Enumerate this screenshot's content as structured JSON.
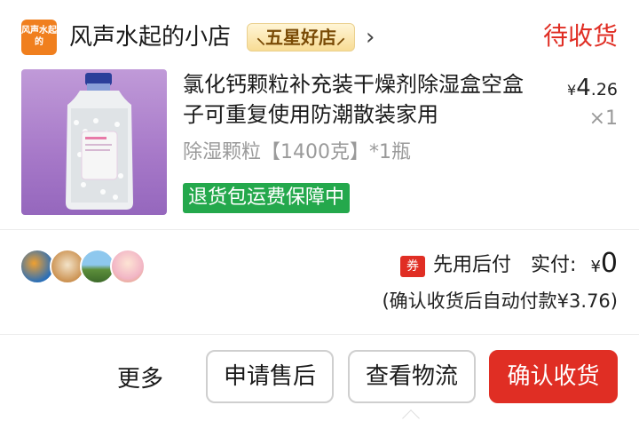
{
  "shop": {
    "logo_text": "风声水起的",
    "name": "风声水起的小店",
    "badge": "五星好店",
    "status": "待收货"
  },
  "product": {
    "title": "氯化钙颗粒补充装干燥剂除湿盒空盒子可重复使用防潮散装家用",
    "spec": "除湿颗粒【1400克】*1瓶",
    "guarantee": "退货包运费保障中",
    "price_symbol": "¥",
    "price_int": "4",
    "price_dec": ".26",
    "quantity": "×1"
  },
  "payment": {
    "paylater_icon": "券",
    "paylater_label": "先用后付",
    "paid_label": "实付:",
    "paid_symbol": "¥",
    "paid_amount": "0",
    "auto_pay_note": "(确认收货后自动付款¥3.76)"
  },
  "actions": {
    "more": "更多",
    "after_sale": "申请售后",
    "logistics": "查看物流",
    "confirm": "确认收货"
  },
  "colors": {
    "accent_red": "#e02e24",
    "guarantee_green": "#24a84c",
    "shop_logo_orange": "#f07f1e"
  }
}
